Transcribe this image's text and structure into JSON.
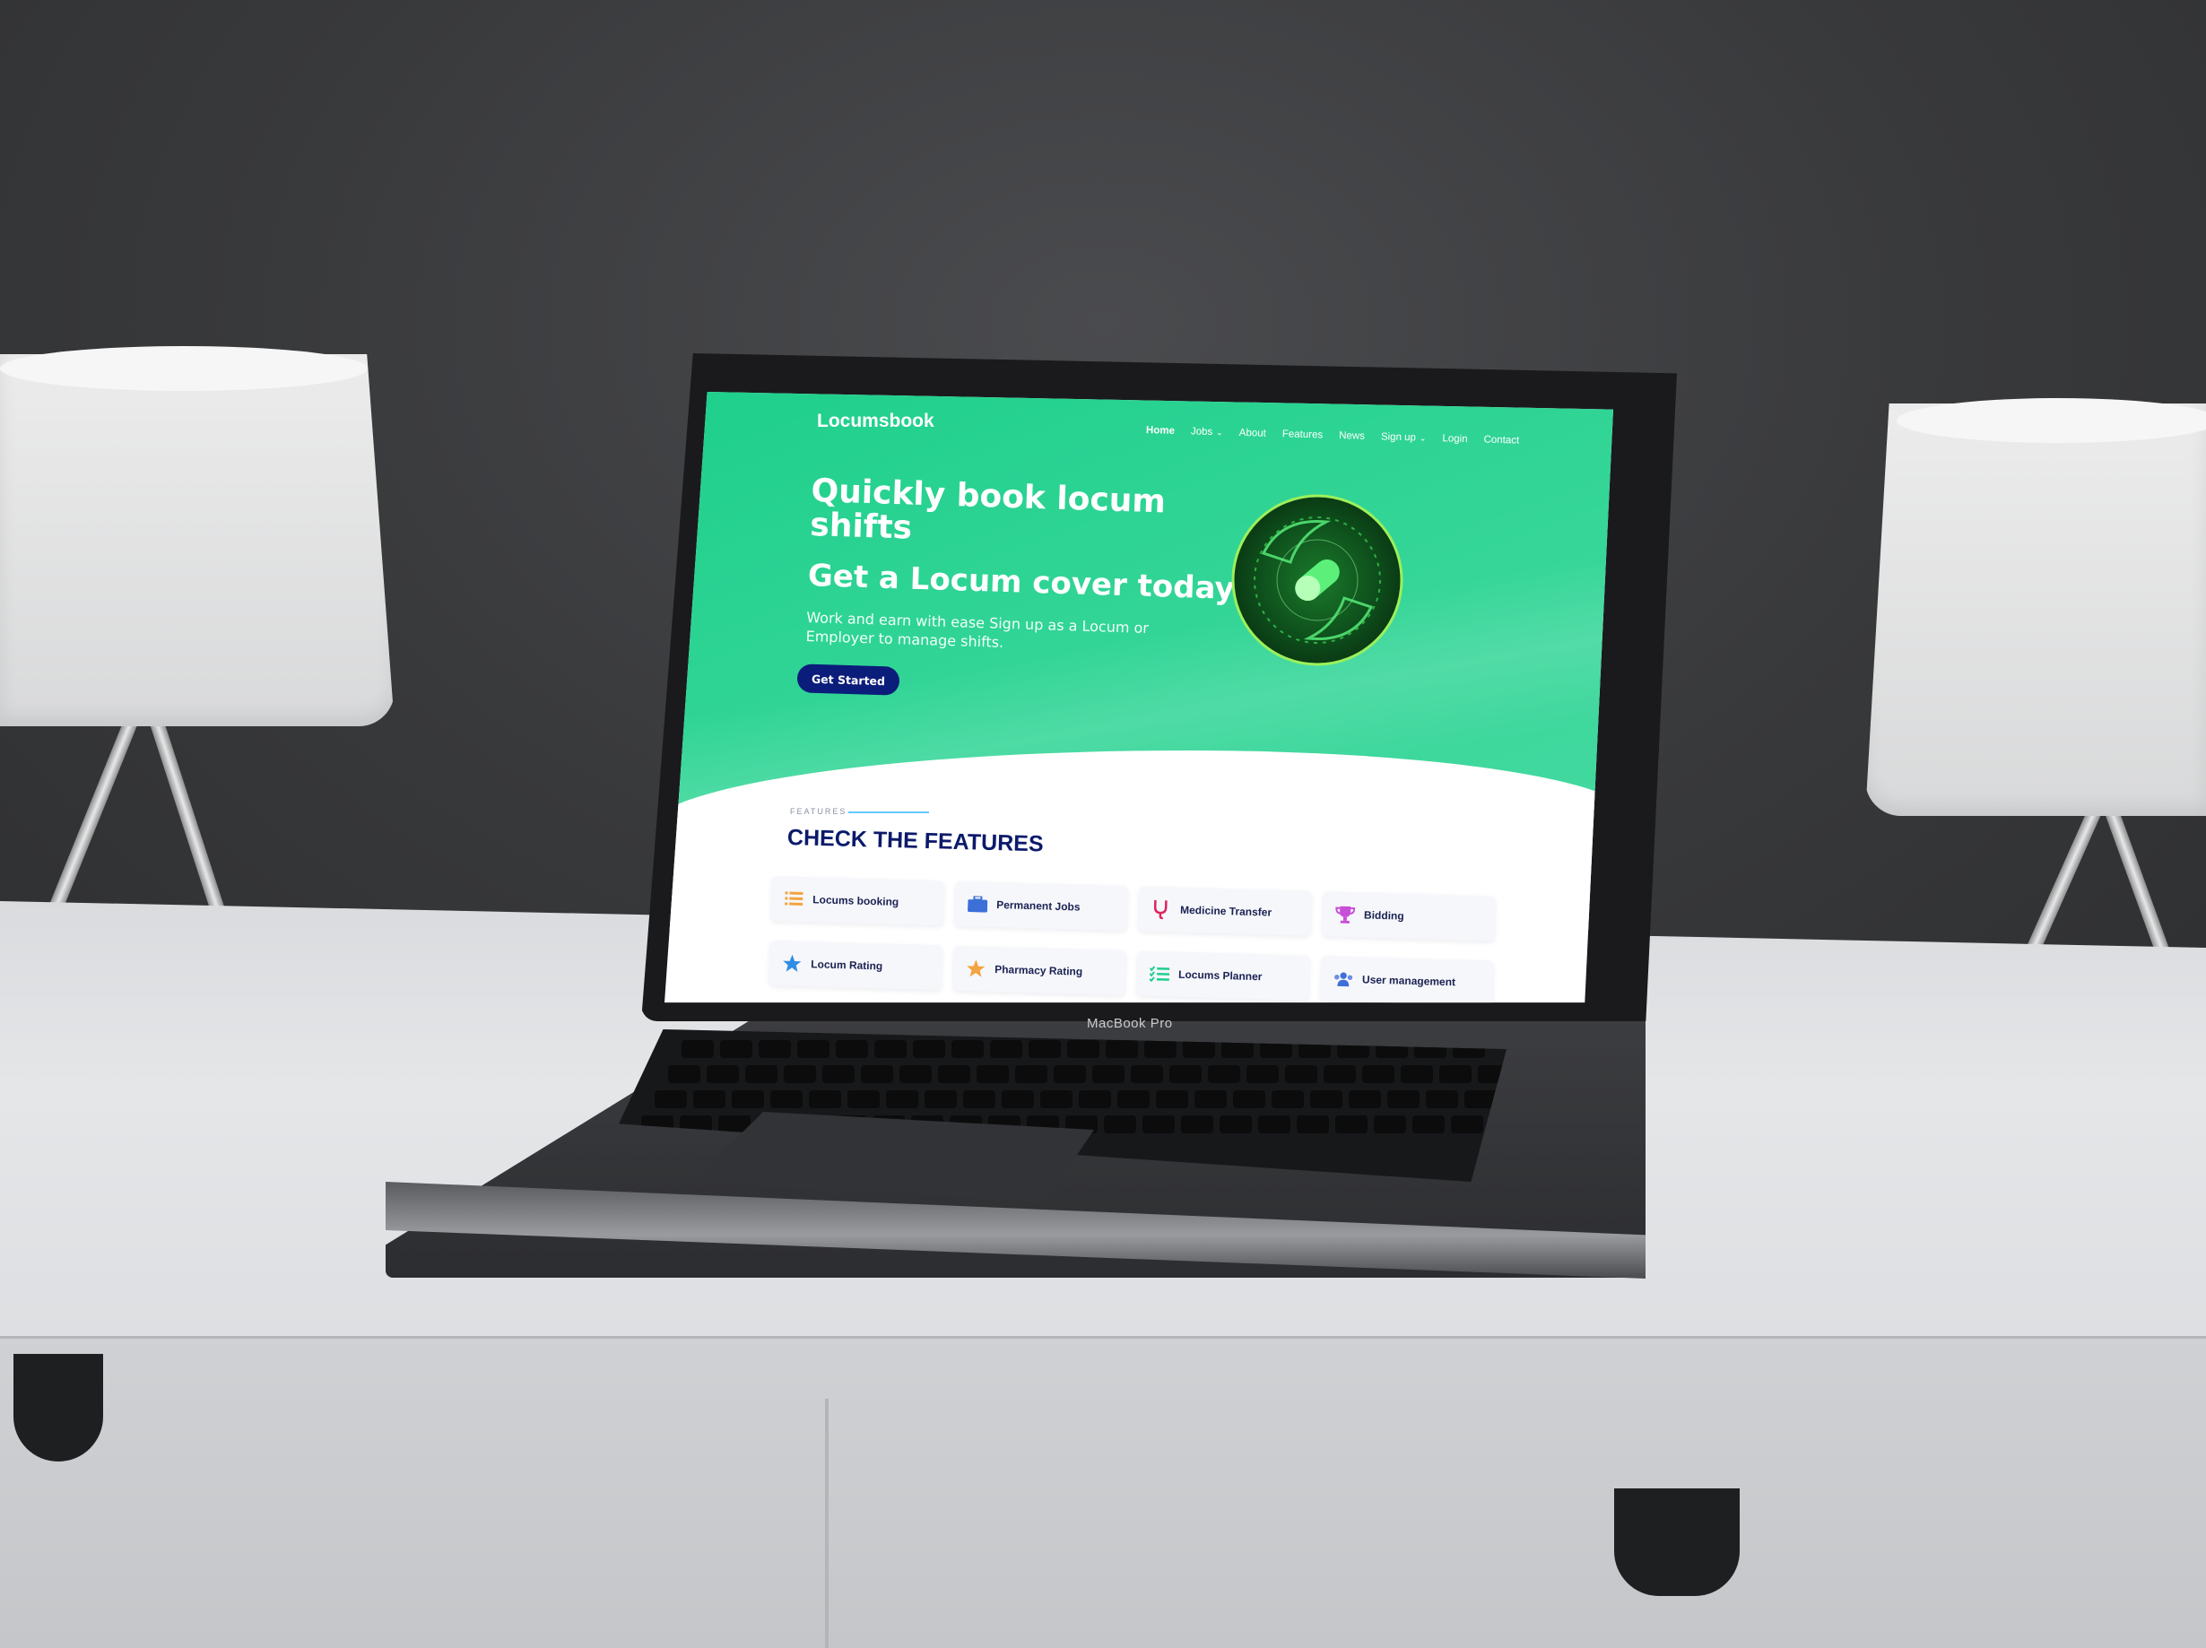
{
  "site": {
    "brand": "Locumsbook",
    "nav": [
      {
        "label": "Home",
        "active": true,
        "dropdown": false
      },
      {
        "label": "Jobs",
        "active": false,
        "dropdown": true
      },
      {
        "label": "About",
        "active": false,
        "dropdown": false
      },
      {
        "label": "Features",
        "active": false,
        "dropdown": false
      },
      {
        "label": "News",
        "active": false,
        "dropdown": false
      },
      {
        "label": "Sign up",
        "active": false,
        "dropdown": true
      },
      {
        "label": "Login",
        "active": false,
        "dropdown": false
      },
      {
        "label": "Contact",
        "active": false,
        "dropdown": false
      }
    ],
    "hero": {
      "title": "Quickly book locum shifts",
      "subtitle": "Get a Locum cover today",
      "text": "Work and earn with ease Sign up as a Locum or Employer to manage shifts.",
      "cta_label": "Get Started"
    },
    "features": {
      "eyebrow": "FEATURES",
      "title": "CHECK THE FEATURES",
      "items": [
        {
          "label": "Locums booking",
          "icon": "list-icon",
          "color": "#f4a340"
        },
        {
          "label": "Permanent Jobs",
          "icon": "briefcase-icon",
          "color": "#3d6fd8"
        },
        {
          "label": "Medicine Transfer",
          "icon": "stethoscope-icon",
          "color": "#e0245e"
        },
        {
          "label": "Bidding",
          "icon": "trophy-icon",
          "color": "#c84fd8"
        },
        {
          "label": "Locum Rating",
          "icon": "star-icon",
          "color": "#2f8de4"
        },
        {
          "label": "Pharmacy Rating",
          "icon": "star-icon",
          "color": "#f4a340"
        },
        {
          "label": "Locums Planner",
          "icon": "checklist-icon",
          "color": "#1fcf8c"
        },
        {
          "label": "User management",
          "icon": "users-icon",
          "color": "#3d6fd8"
        }
      ]
    },
    "colors": {
      "hero_green": "#2ed494",
      "cta_blue": "#0b1d7a",
      "title_navy": "#0c1a6b"
    }
  },
  "device": {
    "label": "MacBook Pro"
  }
}
